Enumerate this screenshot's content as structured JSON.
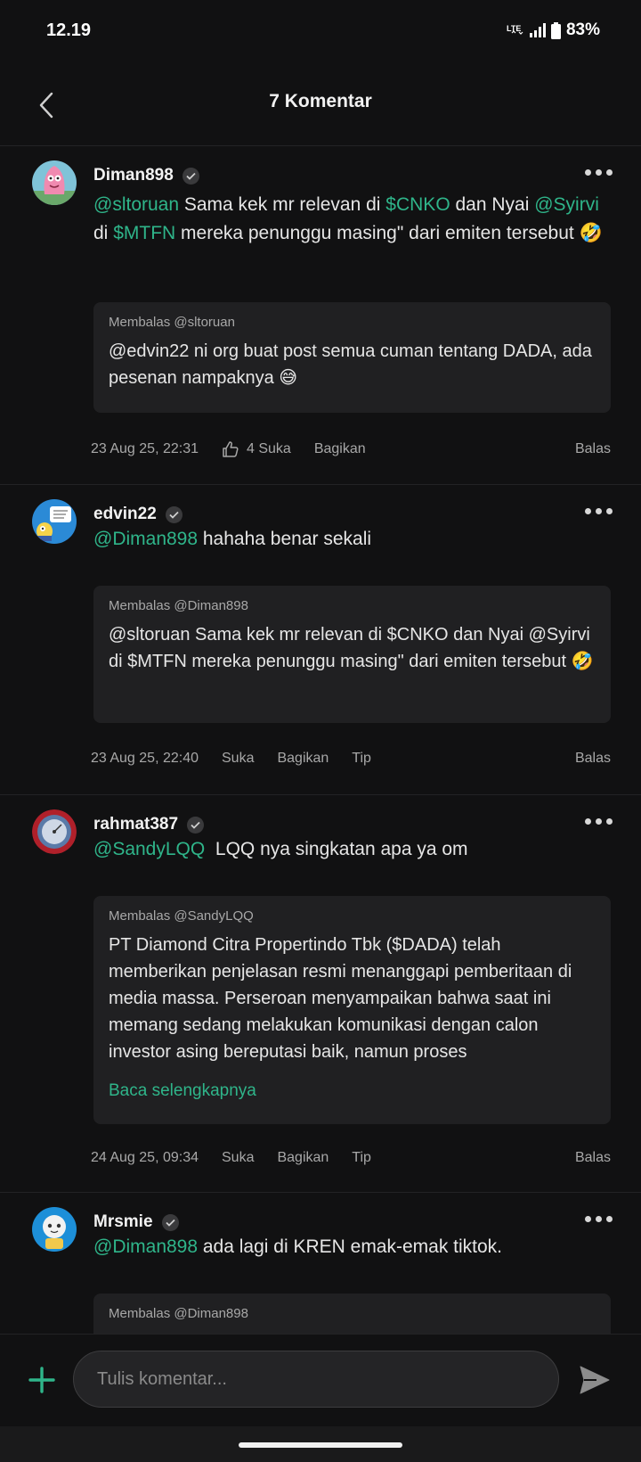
{
  "status_bar": {
    "time": "12.19",
    "network": "LTE",
    "battery": "83%"
  },
  "header": {
    "title": "7 Komentar"
  },
  "comments": [
    {
      "username": "Diman898",
      "body": {
        "m1": "@sltoruan",
        "t1": " Sama kek mr relevan di ",
        "m2": "$CNKO",
        "t2": " dan Nyai ",
        "m3": "@Syirvi",
        "t3": " di ",
        "m4": "$MTFN",
        "t4": " mereka penunggu masing\" dari emiten tersebut 🤣"
      },
      "reply": {
        "label": "Membalas @sltoruan",
        "text": "@edvin22 ni org buat post semua cuman tentang DADA, ada pesenan nampaknya 😅"
      },
      "meta": {
        "time": "23 Aug 25, 22:31",
        "likes": "4 Suka",
        "share": "Bagikan",
        "reply": "Balas"
      }
    },
    {
      "username": "edvin22",
      "body": {
        "m1": "@Diman898",
        "t1": " hahaha benar sekali"
      },
      "reply": {
        "label": "Membalas @Diman898",
        "text": "@sltoruan Sama kek mr relevan di $CNKO dan Nyai @Syirvi di $MTFN mereka penunggu masing\" dari emiten tersebut 🤣"
      },
      "meta": {
        "time": "23 Aug 25, 22:40",
        "like": "Suka",
        "share": "Bagikan",
        "tip": "Tip",
        "reply": "Balas"
      }
    },
    {
      "username": "rahmat387",
      "body": {
        "m1": "@SandyLQQ",
        "t1": "  LQQ nya singkatan apa ya om"
      },
      "reply": {
        "label": "Membalas @SandyLQQ",
        "text": "PT Diamond Citra Propertindo Tbk ($DADA) telah memberikan penjelasan resmi menanggapi pemberitaan di media massa. Perseroan menyampaikan bahwa saat ini memang sedang melakukan komunikasi dengan calon investor asing bereputasi baik, namun proses",
        "read_more": "Baca selengkapnya"
      },
      "meta": {
        "time": "24 Aug 25, 09:34",
        "like": "Suka",
        "share": "Bagikan",
        "tip": "Tip",
        "reply": "Balas"
      }
    },
    {
      "username": "Mrsmie",
      "body": {
        "m1": "@Diman898",
        "t1": " ada lagi di KREN emak-emak tiktok."
      },
      "reply": {
        "label": "Membalas @Diman898"
      }
    }
  ],
  "composer": {
    "placeholder": "Tulis komentar..."
  },
  "colors": {
    "accent": "#2fb58a",
    "background": "#111112",
    "card": "#202022"
  }
}
